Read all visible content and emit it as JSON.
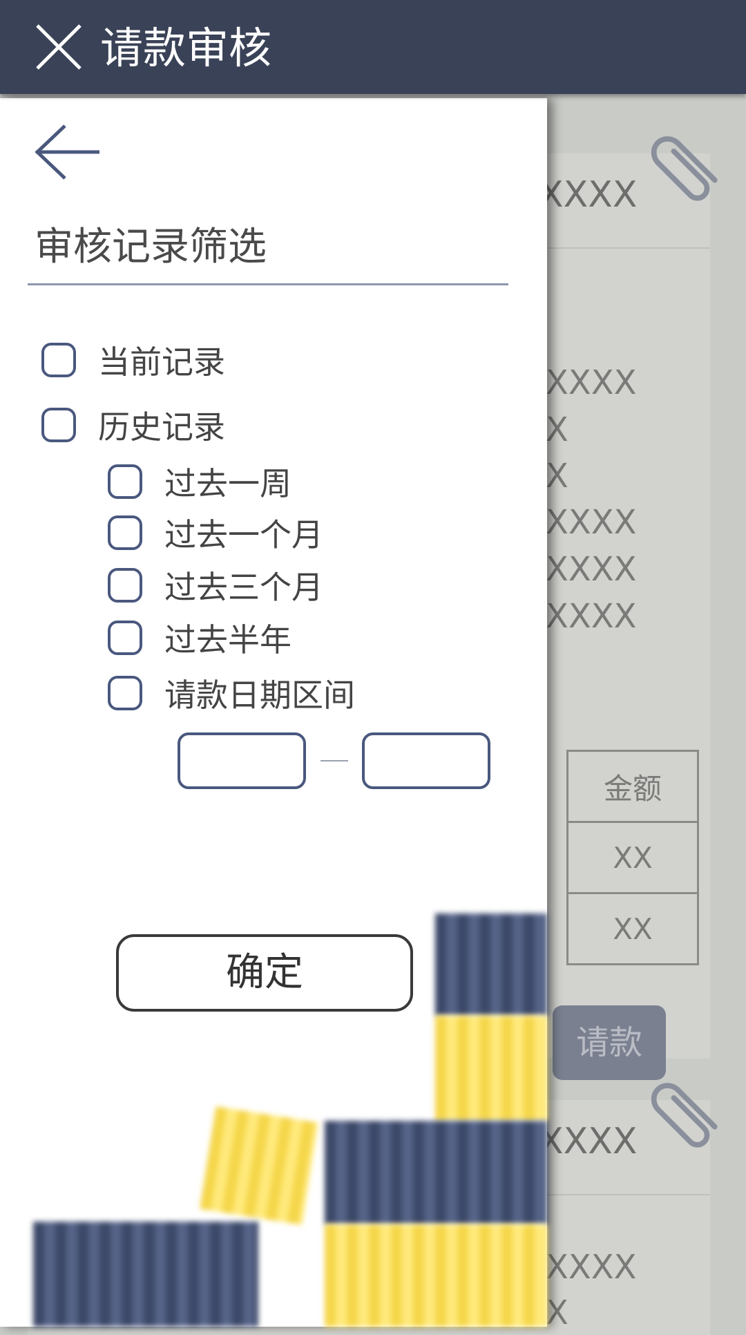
{
  "appbar": {
    "title": "请款审核"
  },
  "drawer": {
    "title": "审核记录筛选",
    "options": {
      "current": "当前记录",
      "history": "历史记录",
      "past_week": "过去一周",
      "past_month": "过去一个月",
      "past_three_months": "过去三个月",
      "past_half_year": "过去半年",
      "date_range": "请款日期区间"
    },
    "confirm_label": "确定"
  },
  "background": {
    "card1": {
      "header_text": "XXXX",
      "lines": [
        "XXXX",
        "X",
        "X",
        "XXXX",
        "XXXX",
        "XXXX"
      ],
      "table": {
        "header": "金额",
        "rows": [
          "XX",
          "XX"
        ]
      },
      "button_label": "请款"
    },
    "card2": {
      "header_text": "XXXX",
      "lines": [
        "XXXX",
        "X"
      ]
    }
  },
  "icons": [
    "close-icon",
    "back-arrow-icon",
    "paperclip-icon"
  ],
  "colors": {
    "appbar_bg": "#3a4257",
    "accent_border": "#4a587e",
    "drawer_bg": "#ffffff",
    "overlay_bg": "#c9cbc7"
  }
}
